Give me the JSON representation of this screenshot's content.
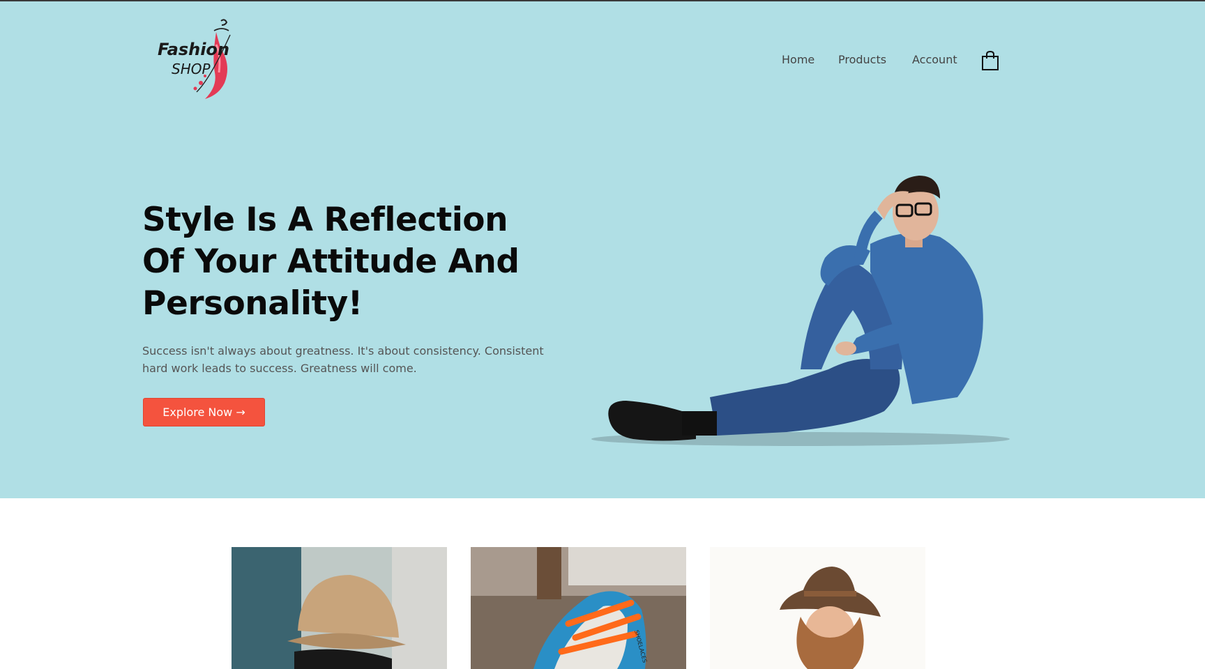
{
  "brand": {
    "logo_line1": "Fashion",
    "logo_line2": "SHOP"
  },
  "nav": {
    "items": [
      {
        "label": "Home"
      },
      {
        "label": "Products"
      },
      {
        "label": "Account"
      }
    ],
    "cart_icon": "shopping-bag-icon"
  },
  "hero": {
    "headline_line1": "Style Is A Reflection",
    "headline_line2": "Of Your Attitude And",
    "headline_line3": "Personality!",
    "subtext": "Success isn't always about greatness. It's about consistency. Consistent hard work leads to success. Greatness will come.",
    "cta_label": "Explore Now →",
    "background_color": "#b0dfe5",
    "cta_color": "#f4533e"
  },
  "products": {
    "items": [
      {
        "image": "bucket-hat-photo"
      },
      {
        "image": "sneakers-photo",
        "shoe_text": "SHOELACES"
      },
      {
        "image": "fedora-hat-woman-photo"
      }
    ]
  }
}
